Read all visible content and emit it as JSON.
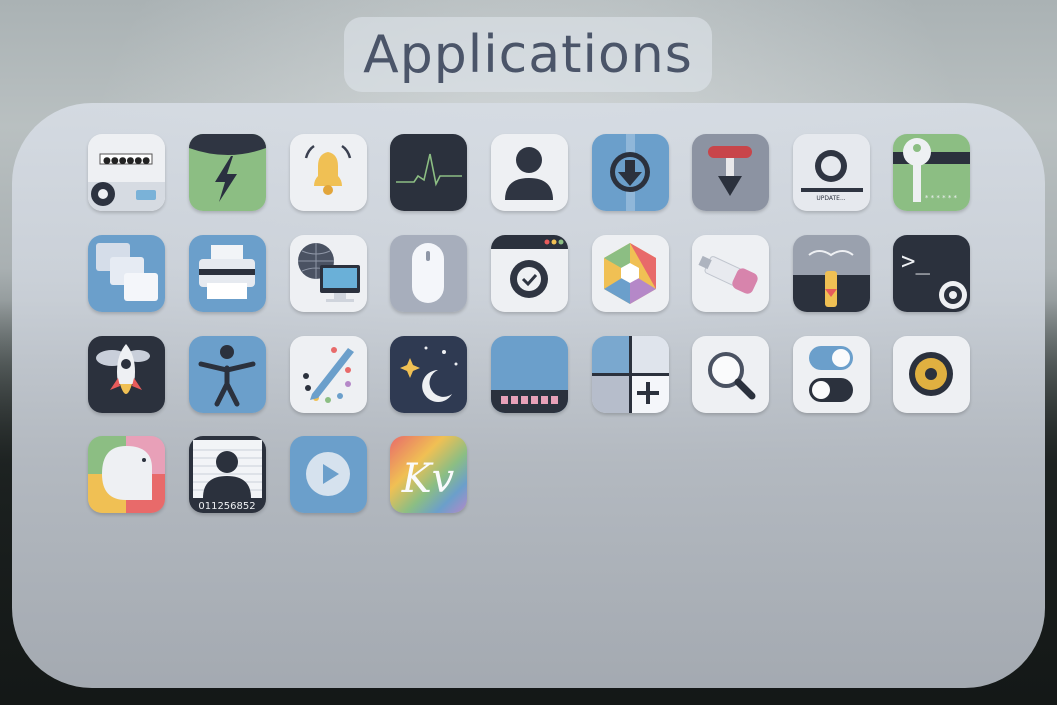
{
  "window": {
    "title": "Applications"
  },
  "apps": [
    {
      "icon": "login-settings-icon",
      "text": "●●●●●●"
    },
    {
      "icon": "power-statistics-icon"
    },
    {
      "icon": "notifications-bell-icon"
    },
    {
      "icon": "system-monitor-icon"
    },
    {
      "icon": "user-accounts-icon"
    },
    {
      "icon": "downloader-icon"
    },
    {
      "icon": "usb-eject-icon"
    },
    {
      "icon": "software-updater-icon",
      "text": "UPDATE..."
    },
    {
      "icon": "passwords-keys-icon",
      "text": "* * * * * *"
    },
    {
      "icon": "workspaces-icon"
    },
    {
      "icon": "printer-icon"
    },
    {
      "icon": "network-globe-computer-icon"
    },
    {
      "icon": "mouse-icon"
    },
    {
      "icon": "system-settings-icon"
    },
    {
      "icon": "photos-icon"
    },
    {
      "icon": "usb-drive-icon"
    },
    {
      "icon": "boot-repair-icon"
    },
    {
      "icon": "terminal-settings-icon",
      "text": ">_"
    },
    {
      "icon": "rocket-launcher-icon"
    },
    {
      "icon": "accessibility-icon"
    },
    {
      "icon": "drawing-palette-icon"
    },
    {
      "icon": "night-mode-icon"
    },
    {
      "icon": "panel-dock-icon"
    },
    {
      "icon": "add-workspace-icon"
    },
    {
      "icon": "search-magnifier-icon"
    },
    {
      "icon": "toggle-switches-icon"
    },
    {
      "icon": "audio-speaker-icon"
    },
    {
      "icon": "chat-bubble-icon"
    },
    {
      "icon": "user-id-card-icon",
      "text": "011256852"
    },
    {
      "icon": "media-player-icon"
    },
    {
      "icon": "krita-kv-icon",
      "text": "Kv"
    }
  ]
}
